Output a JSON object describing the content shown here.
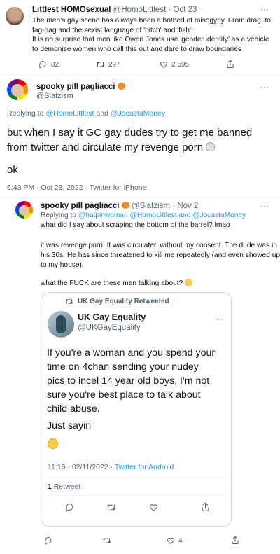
{
  "tweet1": {
    "name": "Littlest HOMOsexual",
    "handle": "@HomoLittlest",
    "dot": "·",
    "date": "Oct 23",
    "lines": [
      "The men's gay scene has always been a hotbed of misogyny. From drag, to",
      "fag-hag and the sexist language of 'bitch' and 'fish'.",
      "It is no surprise that men like Owen Jones use 'gender identity'  as a vehicle",
      "to demonise women who call this out and dare to draw boundaries"
    ],
    "reply_count": "82",
    "retweet_count": "297",
    "like_count": "2,595",
    "more": "···"
  },
  "tweet2": {
    "name": "spooky pill pagliacci",
    "handle": "@Slatzism",
    "more": "···",
    "replying_prefix": "Replying to ",
    "replying_to": "@HomoLittlest",
    "and": " and ",
    "replying_to2": "@JocastaMoney",
    "body1": "but when I say it GC gay dudes try to get me banned",
    "body2": "from twitter and circulate my revenge porn",
    "body3": "ok",
    "timestamp": "6:43 PM · Oct 23, 2022 · Twitter for iPhone"
  },
  "tweet3": {
    "name": "spooky pill pagliacci",
    "handle": "@Slatzism",
    "dot": "·",
    "date": "Nov 2",
    "more": "···",
    "replying_prefix": "Replying to ",
    "mentions": "@hatpinwoman @HomoLittlest and @JocastaMoney",
    "line1": "what did I say about scraping the bottom of the barrel? lmao",
    "para2": [
      "it was revenge porn. It was circulated without my consent. The dude was in",
      "his 30s. He has since threatened to kill me repeatedly (and even showed up",
      "to my house)."
    ],
    "line3": "what the FUCK are these men talking about?",
    "like_count": "4"
  },
  "quoted": {
    "retweeted_label": "UK Gay Equality Retweeted",
    "name": "UK Gay Equality",
    "handle": "@UKGayEquality",
    "more": "···",
    "lines": [
      "If you're a woman and you spend your",
      "time on 4chan sending your nudey",
      "pics to incel 14 year old boys, I'm not",
      "sure you're best place to talk about",
      "child abuse."
    ],
    "line_extra": "Just sayin'",
    "time": "11:16 · 02/11/2022 · ",
    "source": "Twitter for Android",
    "retweet_count": "1",
    "retweet_word": " Retweet"
  },
  "colors": {
    "accent": "#1d9bf0",
    "text": "#0f1419",
    "muted": "#536471"
  }
}
